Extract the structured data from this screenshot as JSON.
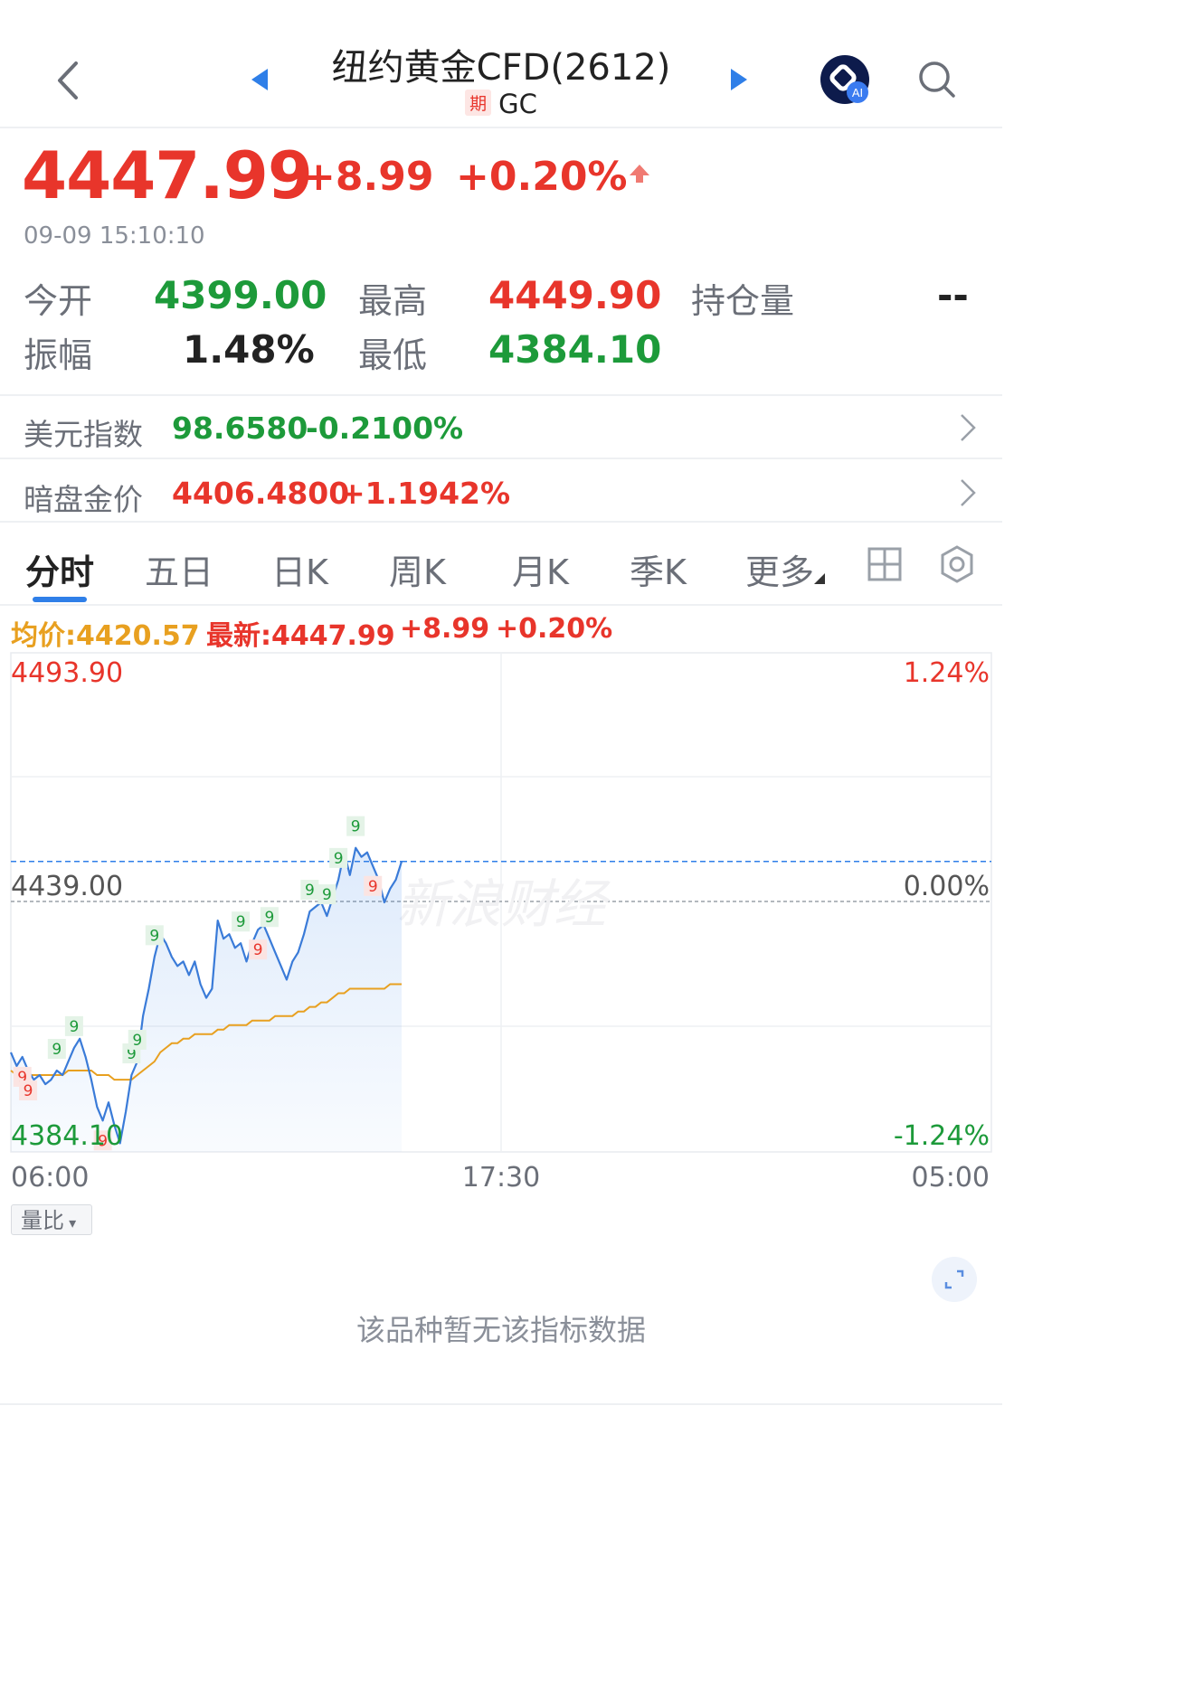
{
  "header": {
    "title": "纽约黄金CFD(2612)",
    "badge": "期",
    "code": "GC"
  },
  "quote": {
    "price": "4447.99",
    "change": "+8.99",
    "change_pct": "+0.20%",
    "time": "09-09 15:10:10"
  },
  "stats": {
    "open_label": "今开",
    "open": "4399.00",
    "high_label": "最高",
    "high": "4449.90",
    "oi_label": "持仓量",
    "oi": "--",
    "amp_label": "振幅",
    "amp": "1.48%",
    "low_label": "最低",
    "low": "4384.10"
  },
  "related": [
    {
      "label": "美元指数",
      "value": "98.6580",
      "pct": "-0.2100%"
    },
    {
      "label": "暗盘金价",
      "value": "4406.4800",
      "pct": "+1.1942%"
    }
  ],
  "tabs": [
    "分时",
    "五日",
    "日K",
    "周K",
    "月K",
    "季K",
    "更多"
  ],
  "legend": {
    "avg": "均价:4420.57",
    "latest": "最新:4447.99",
    "change": "+8.99",
    "pct": "+0.20%"
  },
  "chart": {
    "y_top": "4493.90",
    "y_mid": "4439.00",
    "y_bottom": "4384.10",
    "pct_top": "1.24%",
    "pct_mid": "0.00%",
    "pct_bottom": "-1.24%",
    "x_labels": [
      "06:00",
      "17:30",
      "05:00"
    ],
    "watermark": "新浪财经"
  },
  "chart_data": {
    "type": "line",
    "ylim": [
      4384.1,
      4493.9
    ],
    "prev_close": 4439.0,
    "series": [
      {
        "name": "price",
        "values": [
          4406,
          4403,
          4405,
          4402,
          4400,
          4401,
          4399,
          4400,
          4402,
          4401,
          4404,
          4407,
          4409,
          4405,
          4400,
          4394,
          4391,
          4395,
          4390,
          4386,
          4393,
          4401,
          4404,
          4414,
          4420,
          4427,
          4432,
          4430,
          4427,
          4425,
          4426,
          4423,
          4426,
          4421,
          4418,
          4420,
          4435,
          4431,
          4432,
          4429,
          4430,
          4426,
          4430,
          4433,
          4434,
          4431,
          4428,
          4425,
          4422,
          4426,
          4428,
          4432,
          4437,
          4438,
          4439,
          4436,
          4440,
          4444,
          4450,
          4445,
          4451,
          4449,
          4450,
          4447,
          4444,
          4439,
          4442,
          4444,
          4448
        ]
      },
      {
        "name": "avg",
        "values": [
          4402,
          4401,
          4401,
          4401,
          4401,
          4401,
          4401,
          4401,
          4401,
          4401,
          4402,
          4402,
          4402,
          4402,
          4402,
          4401,
          4401,
          4401,
          4400,
          4400,
          4400,
          4400,
          4401,
          4402,
          4403,
          4404,
          4406,
          4407,
          4408,
          4408,
          4409,
          4409,
          4410,
          4410,
          4410,
          4410,
          4411,
          4411,
          4412,
          4412,
          4412,
          4412,
          4413,
          4413,
          4413,
          4413,
          4414,
          4414,
          4414,
          4414,
          4415,
          4415,
          4416,
          4416,
          4417,
          4417,
          4418,
          4419,
          4419,
          4420,
          4420,
          4420,
          4420,
          4420,
          4420,
          4420,
          4421,
          4421,
          4421
        ]
      }
    ],
    "markers": [
      {
        "i": 2,
        "color": "red"
      },
      {
        "i": 3,
        "color": "red"
      },
      {
        "i": 8,
        "color": "green"
      },
      {
        "i": 11,
        "color": "green"
      },
      {
        "i": 16,
        "color": "red"
      },
      {
        "i": 21,
        "color": "green"
      },
      {
        "i": 22,
        "color": "green"
      },
      {
        "i": 25,
        "color": "green"
      },
      {
        "i": 40,
        "color": "green"
      },
      {
        "i": 43,
        "color": "red"
      },
      {
        "i": 45,
        "color": "green"
      },
      {
        "i": 52,
        "color": "green"
      },
      {
        "i": 55,
        "color": "green"
      },
      {
        "i": 57,
        "color": "green"
      },
      {
        "i": 60,
        "color": "green"
      },
      {
        "i": 63,
        "color": "red"
      }
    ]
  },
  "volume_tab": "量比",
  "no_data": "该品种暂无该指标数据"
}
